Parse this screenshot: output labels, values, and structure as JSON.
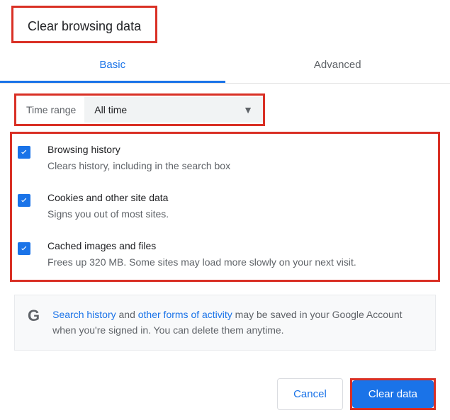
{
  "title": "Clear browsing data",
  "tabs": {
    "basic": "Basic",
    "advanced": "Advanced"
  },
  "timeRange": {
    "label": "Time range",
    "value": "All time"
  },
  "options": [
    {
      "title": "Browsing history",
      "desc": "Clears history, including in the search box",
      "checked": true
    },
    {
      "title": "Cookies and other site data",
      "desc": "Signs you out of most sites.",
      "checked": true
    },
    {
      "title": "Cached images and files",
      "desc": "Frees up 320 MB. Some sites may load more slowly on your next visit.",
      "checked": true
    }
  ],
  "info": {
    "link1": "Search history",
    "mid1": " and ",
    "link2": "other forms of activity",
    "rest": " may be saved in your Google Account when you're signed in. You can delete them anytime."
  },
  "buttons": {
    "cancel": "Cancel",
    "clear": "Clear data"
  },
  "highlightColor": "#d93025",
  "accentColor": "#1a73e8"
}
